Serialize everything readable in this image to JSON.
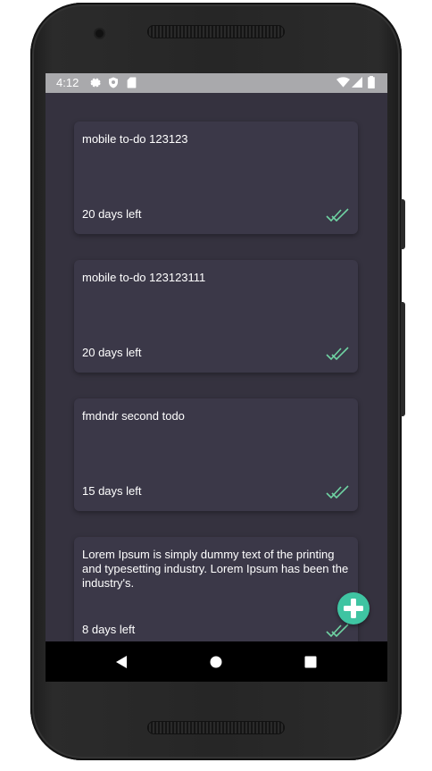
{
  "status_bar": {
    "time": "4:12",
    "icons_left": [
      "gear-icon",
      "shield-icon",
      "sd-card-icon"
    ],
    "icons_right": [
      "wifi-icon",
      "signal-icon",
      "battery-icon"
    ]
  },
  "todos": [
    {
      "title": "mobile to-do 123123",
      "days_left": "20 days left",
      "done": true
    },
    {
      "title": "mobile to-do 123123111",
      "days_left": "20 days left",
      "done": true
    },
    {
      "title": "fmdndr second todo",
      "days_left": "15 days left",
      "done": true
    },
    {
      "title": "Lorem Ipsum is simply dummy text of the printing and typesetting industry. Lorem Ipsum has been the industry's.",
      "days_left": "8 days left",
      "done": true
    }
  ],
  "fab": {
    "icon": "plus-icon"
  },
  "nav": [
    "back-icon",
    "home-icon",
    "recents-icon"
  ],
  "colors": {
    "background": "#35323f",
    "card": "#3b3848",
    "accent": "#3fc4a2",
    "check": "#6fd3a3",
    "status_bar": "#a9a9ac"
  }
}
